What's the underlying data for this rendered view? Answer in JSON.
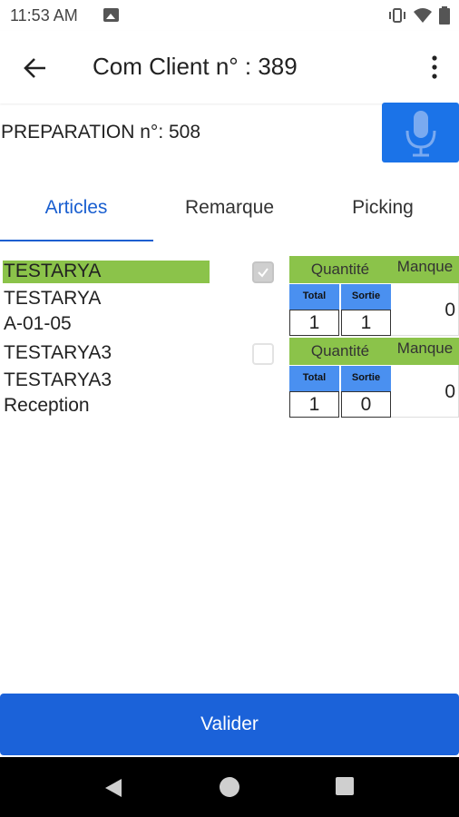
{
  "status_bar": {
    "time": "11:53 AM",
    "icons": [
      "image-icon",
      "vibrate-icon",
      "wifi-icon",
      "battery-icon"
    ]
  },
  "app_bar": {
    "title": "Com Client n° : 389",
    "back_icon": "arrow-back-icon",
    "menu_icon": "more-vert-icon"
  },
  "preparation": {
    "label": "PREPARATION n°: 508",
    "mic_icon": "microphone-icon"
  },
  "tabs": [
    {
      "label": "Articles",
      "active": true
    },
    {
      "label": "Remarque",
      "active": false
    },
    {
      "label": "Picking",
      "active": false
    }
  ],
  "articles": [
    {
      "name": "TESTARYA",
      "code": "TESTARYA",
      "location": "A-01-05",
      "checked": true,
      "quantite_label": "Quantité",
      "manque_label": "Manque",
      "total_label": "Total",
      "sortie_label": "Sortie",
      "total": "1",
      "sortie": "1",
      "manque": "0"
    },
    {
      "name": "TESTARYA3",
      "code": "TESTARYA3",
      "location": "Reception",
      "checked": false,
      "quantite_label": "Quantité",
      "manque_label": "Manque",
      "total_label": "Total",
      "sortie_label": "Sortie",
      "total": "1",
      "sortie": "0",
      "manque": "0"
    }
  ],
  "valider_label": "Valider",
  "colors": {
    "primary": "#1b62d9",
    "accent_green": "#8bc34a",
    "sub_header_blue": "#4a90f0",
    "tab_active": "#1a5fd0"
  }
}
